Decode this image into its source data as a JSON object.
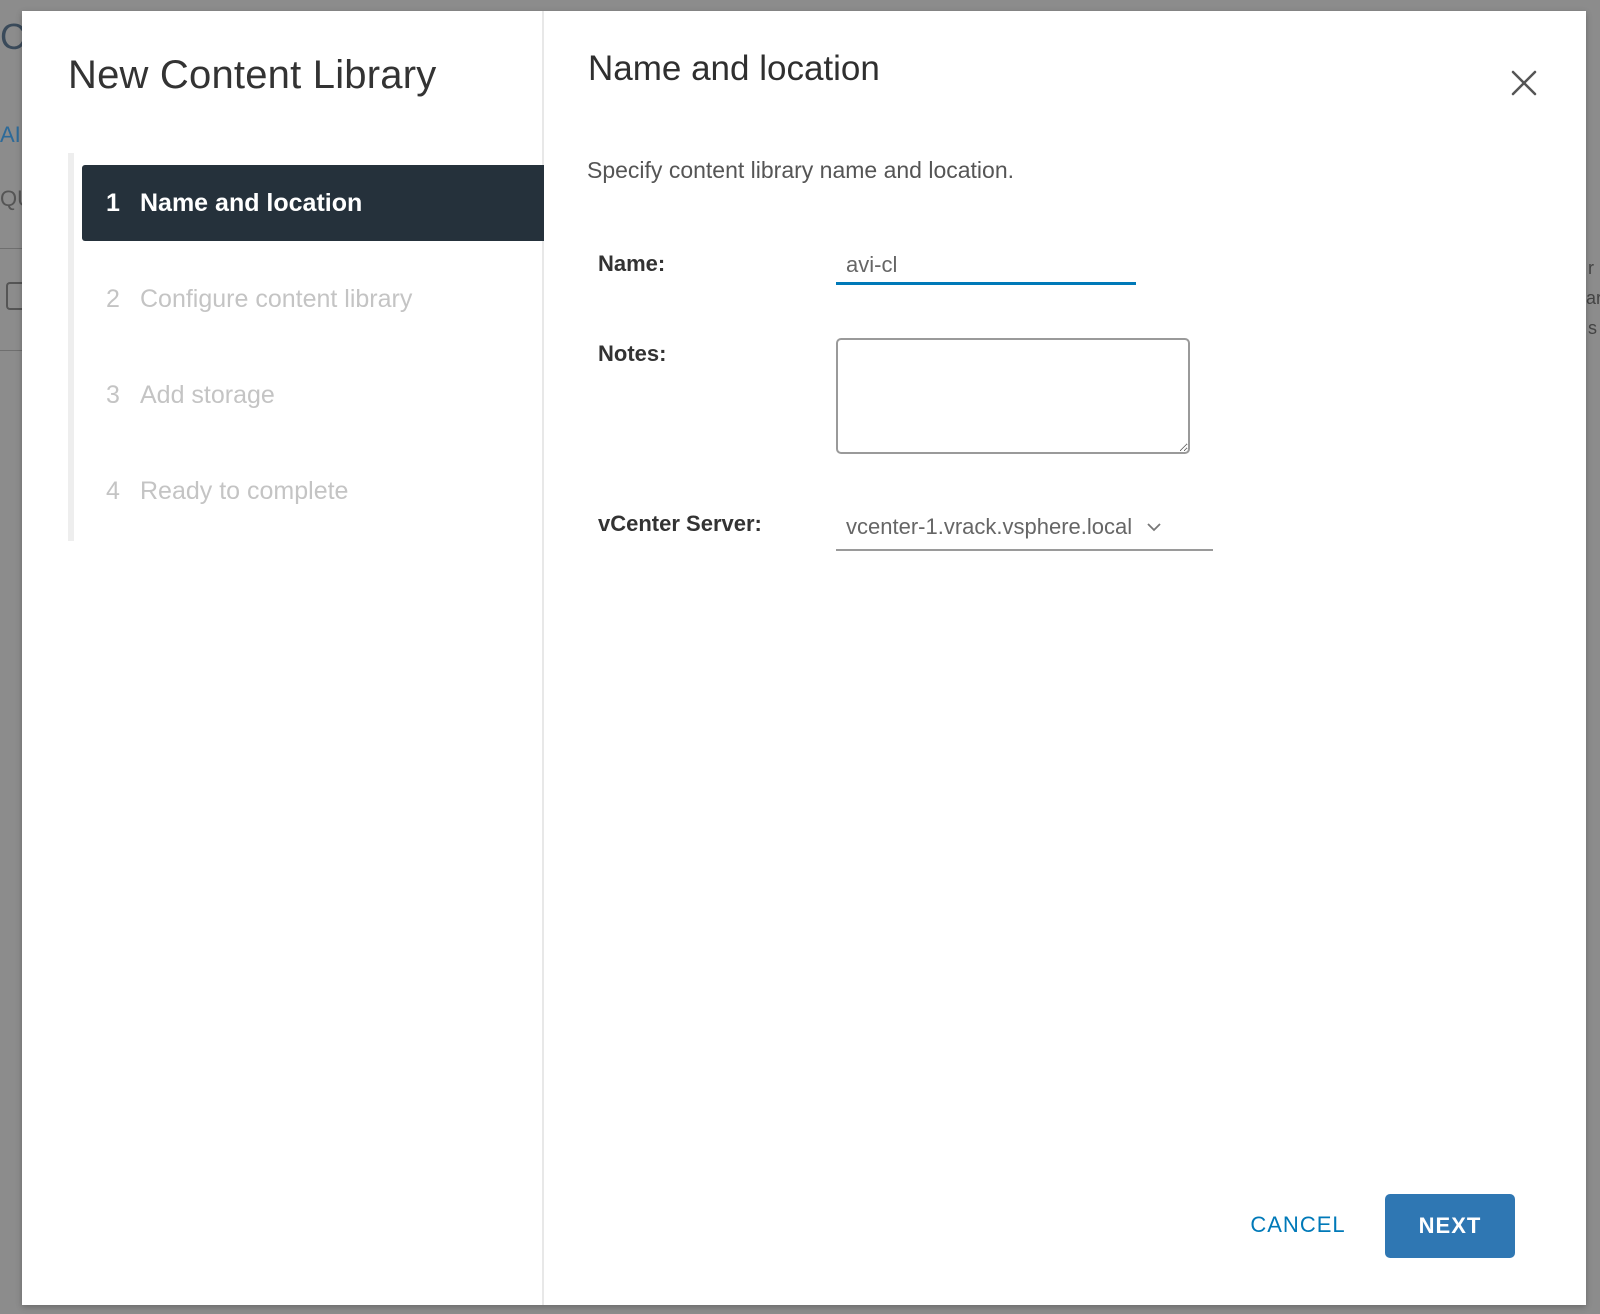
{
  "background": {
    "fragments": [
      "C",
      "AI",
      "QU"
    ],
    "right_fragments": [
      "r",
      "ar",
      "s"
    ]
  },
  "wizard": {
    "title": "New Content Library",
    "steps": [
      {
        "number": "1",
        "label": "Name and location",
        "active": true
      },
      {
        "number": "2",
        "label": "Configure content library",
        "active": false
      },
      {
        "number": "3",
        "label": "Add storage",
        "active": false
      },
      {
        "number": "4",
        "label": "Ready to complete",
        "active": false
      }
    ]
  },
  "content": {
    "title": "Name and location",
    "description": "Specify content library name and location.",
    "form": {
      "name_label": "Name:",
      "name_value": "avi-cl",
      "notes_label": "Notes:",
      "notes_value": "",
      "vcenter_label": "vCenter Server:",
      "vcenter_value": "vcenter-1.vrack.vsphere.local"
    }
  },
  "footer": {
    "cancel_label": "CANCEL",
    "next_label": "NEXT"
  },
  "colors": {
    "accent": "#0079b8",
    "active_step_bg": "#25313b",
    "primary_button": "#2f77b3"
  }
}
